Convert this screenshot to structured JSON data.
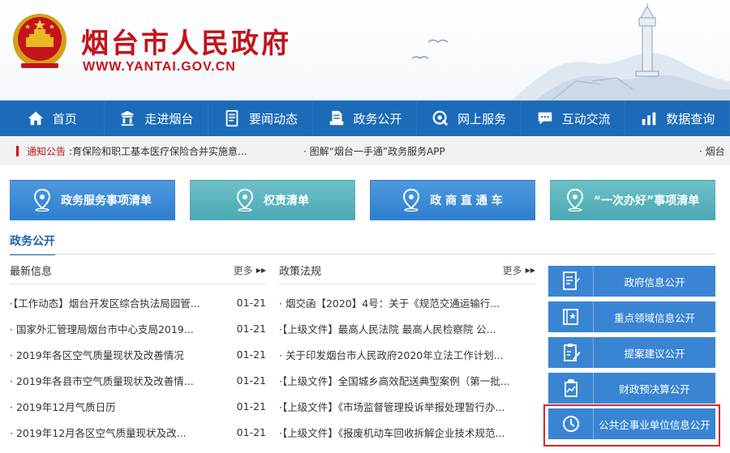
{
  "header": {
    "title": "烟台市人民政府",
    "url": "WWW.YANTAI.GOV.CN"
  },
  "nav": [
    {
      "label": "首页",
      "icon": "home-icon"
    },
    {
      "label": "走进烟台",
      "icon": "building-icon"
    },
    {
      "label": "要闻动态",
      "icon": "news-icon"
    },
    {
      "label": "政务公开",
      "icon": "document-icon"
    },
    {
      "label": "网上服务",
      "icon": "service-icon"
    },
    {
      "label": "互动交流",
      "icon": "chat-icon"
    },
    {
      "label": "数据查询",
      "icon": "chart-icon"
    }
  ],
  "notice": {
    "tag": "通知公告",
    "items": [
      ":育保险和职工基本医疗保险合并实施意...",
      "· 图解“烟台一手通”政务服务APP",
      "· 烟台"
    ]
  },
  "quick_buttons": [
    {
      "label": "政务服务事项清单",
      "style": "blue"
    },
    {
      "label": "权责清单",
      "style": "teal"
    },
    {
      "label": "政 商 直 通 车",
      "style": "blue"
    },
    {
      "label": "“一次办好”事项清单",
      "style": "teal"
    }
  ],
  "section": {
    "title": "政务公开"
  },
  "latest": {
    "heading": "最新信息",
    "more": "更多",
    "items": [
      {
        "title": "·【工作动态】烟台开发区综合执法局园管...",
        "date": "01-21"
      },
      {
        "title": "· 国家外汇管理局烟台市中心支局2019...",
        "date": "01-21"
      },
      {
        "title": "· 2019年各区空气质量现状及改善情况",
        "date": "01-21"
      },
      {
        "title": "· 2019年各县市空气质量现状及改善情...",
        "date": "01-21"
      },
      {
        "title": "· 2019年12月气质日历",
        "date": "01-21"
      },
      {
        "title": "· 2019年12月各区空气质量现状及改...",
        "date": "01-21"
      }
    ]
  },
  "policy": {
    "heading": "政策法规",
    "more": "更多",
    "items": [
      {
        "title": "· 烟交函【2020】4号：关于《规范交通运输行..."
      },
      {
        "title": "·【上级文件】最高人民法院 最高人民检察院 公..."
      },
      {
        "title": "· 关于印发烟台市人民政府2020年立法工作计划..."
      },
      {
        "title": "·【上级文件】全国城乡高效配送典型案例（第一批..."
      },
      {
        "title": "·【上级文件】《市场监督管理投诉举报处理暂行办..."
      },
      {
        "title": "·【上级文件】《报废机动车回收拆解企业技术规范..."
      }
    ]
  },
  "right_panel": [
    {
      "label": "政府信息公开",
      "icon": "file-edit-icon"
    },
    {
      "label": "重点领域信息公开",
      "icon": "star-book-icon"
    },
    {
      "label": "提案建议公开",
      "icon": "clipboard-pen-icon"
    },
    {
      "label": "财政预决算公开",
      "icon": "finance-report-icon"
    },
    {
      "label": "公共企事业单位信息公开",
      "icon": "clock-icon"
    }
  ],
  "colors": {
    "brand_red": "#c3141c",
    "nav_blue": "#1c6bb8",
    "button_blue": "#3a85d3",
    "button_teal": "#4aa9b3",
    "highlight_border": "#e0262a"
  }
}
